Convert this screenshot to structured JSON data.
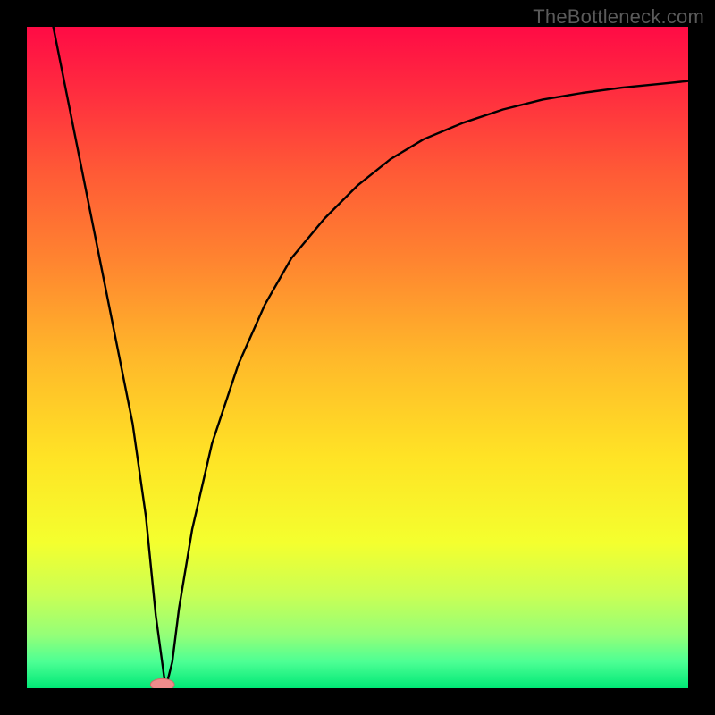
{
  "watermark": "TheBottleneck.com",
  "chart_data": {
    "type": "line",
    "title": "",
    "xlabel": "",
    "ylabel": "",
    "xlim": [
      0,
      100
    ],
    "ylim": [
      0,
      100
    ],
    "grid": false,
    "series": [
      {
        "name": "bottleneck-curve",
        "color": "#000000",
        "x": [
          4,
          6,
          8,
          10,
          12,
          14,
          16,
          18,
          19.5,
          21,
          22,
          23,
          25,
          28,
          32,
          36,
          40,
          45,
          50,
          55,
          60,
          66,
          72,
          78,
          84,
          90,
          96,
          100
        ],
        "y": [
          100,
          90,
          80,
          70,
          60,
          50,
          40,
          26,
          11,
          0,
          4,
          12,
          24,
          37,
          49,
          58,
          65,
          71,
          76,
          80,
          83,
          85.5,
          87.5,
          89,
          90,
          90.8,
          91.4,
          91.8
        ]
      }
    ],
    "marker": {
      "name": "optimal-marker",
      "color_fill": "#f08b8b",
      "color_stroke": "#d46a6a",
      "x": 20.5,
      "y": 0,
      "rx": 1.8,
      "ry": 0.9
    },
    "background_gradient": {
      "stops": [
        {
          "offset": 0.0,
          "color": "#ff0b45"
        },
        {
          "offset": 0.1,
          "color": "#ff2d3f"
        },
        {
          "offset": 0.22,
          "color": "#ff5a36"
        },
        {
          "offset": 0.35,
          "color": "#ff8330"
        },
        {
          "offset": 0.5,
          "color": "#ffb82a"
        },
        {
          "offset": 0.65,
          "color": "#ffe325"
        },
        {
          "offset": 0.78,
          "color": "#f4ff2e"
        },
        {
          "offset": 0.86,
          "color": "#c9ff55"
        },
        {
          "offset": 0.92,
          "color": "#94ff78"
        },
        {
          "offset": 0.96,
          "color": "#4dff94"
        },
        {
          "offset": 1.0,
          "color": "#00e876"
        }
      ]
    }
  }
}
